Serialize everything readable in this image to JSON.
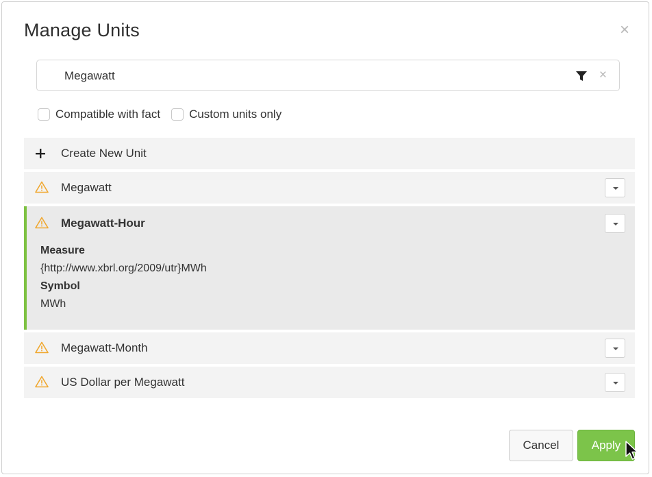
{
  "dialog": {
    "title": "Manage Units",
    "close_icon": "close-icon"
  },
  "search": {
    "value": "Megawatt",
    "filter_icon": "filter-icon",
    "clear_icon": "clear-icon"
  },
  "filters": {
    "compatible_label": "Compatible with fact",
    "custom_label": "Custom units only"
  },
  "create": {
    "icon": "plus-icon",
    "label": "Create New Unit"
  },
  "units": [
    {
      "name": "Megawatt",
      "icon": "warning-icon",
      "expanded": false
    },
    {
      "name": "Megawatt-Hour",
      "icon": "warning-icon",
      "expanded": true,
      "measure_label": "Measure",
      "measure_value": "{http://www.xbrl.org/2009/utr}MWh",
      "symbol_label": "Symbol",
      "symbol_value": "MWh"
    },
    {
      "name": "Megawatt-Month",
      "icon": "warning-icon",
      "expanded": false
    },
    {
      "name": "US Dollar per Megawatt",
      "icon": "warning-icon",
      "expanded": false
    }
  ],
  "footer": {
    "cancel_label": "Cancel",
    "apply_label": "Apply"
  },
  "colors": {
    "accent_green": "#7cc44a",
    "warning_orange": "#f0a830",
    "row_bg": "#f3f3f3",
    "expanded_bg": "#eaeaea"
  }
}
